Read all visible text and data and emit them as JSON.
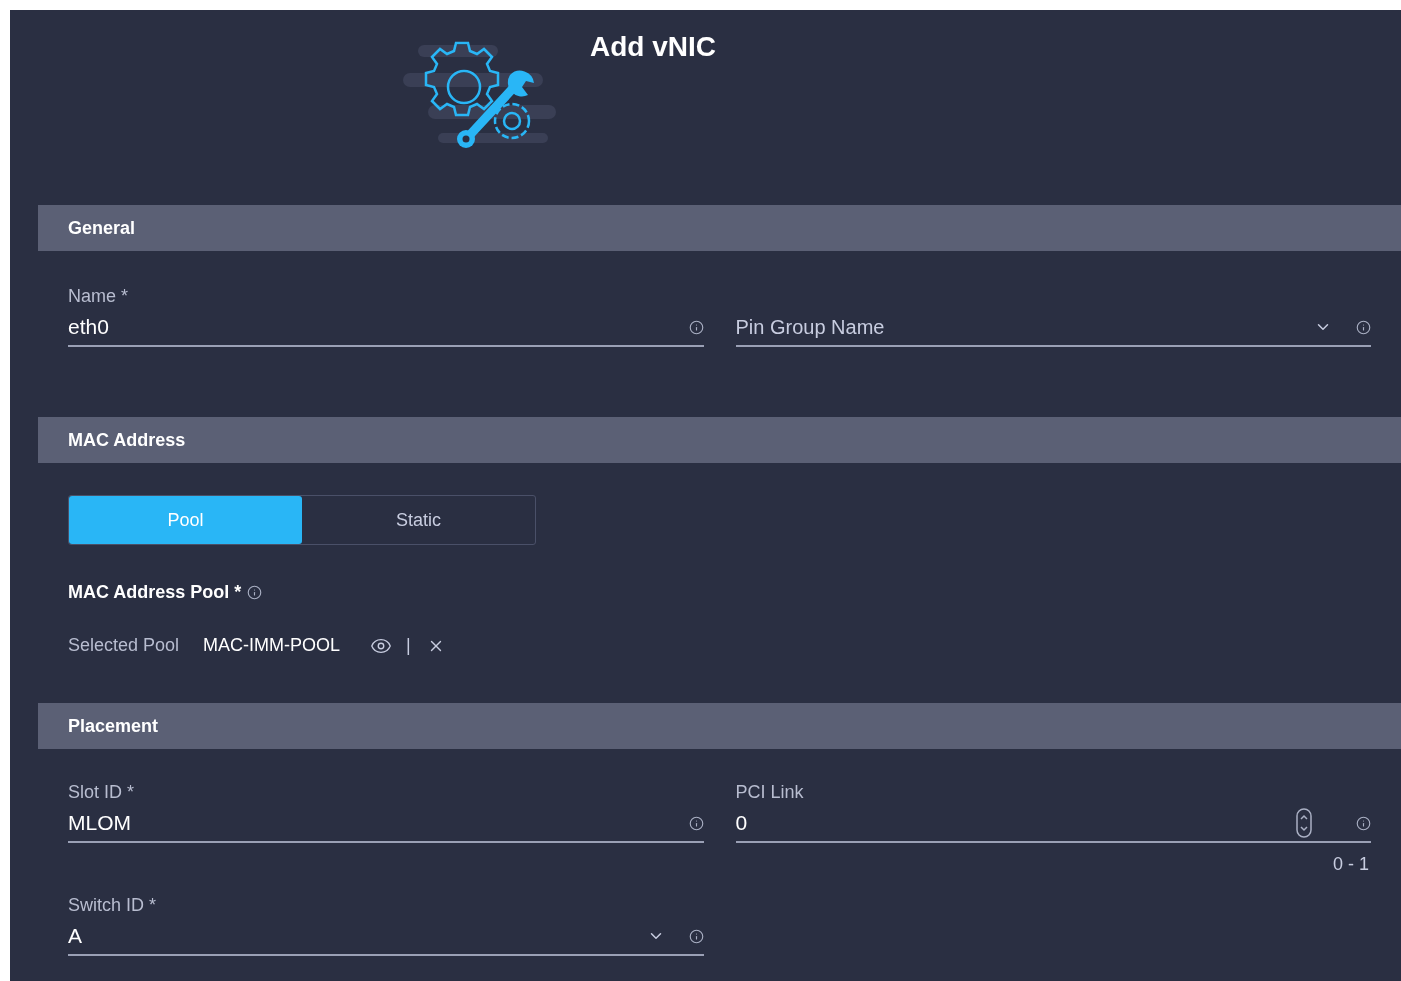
{
  "header": {
    "title": "Add vNIC"
  },
  "general": {
    "title": "General",
    "fields": [
      {
        "kind": "text",
        "label": "Name *",
        "value": "eth0"
      },
      {
        "kind": "select",
        "placeholder": "Pin Group Name"
      }
    ]
  },
  "mac_address": {
    "title": "MAC Address",
    "toggle": [
      {
        "label": "Pool",
        "selected": true
      },
      {
        "label": "Static",
        "selected": false
      }
    ],
    "pool_label": "MAC Address Pool *",
    "selected_label": "Selected Pool",
    "selected_value": "MAC-IMM-POOL",
    "separator": "|"
  },
  "placement": {
    "title": "Placement",
    "fields": [
      {
        "kind": "text",
        "label": "Slot ID *",
        "value": "MLOM"
      },
      {
        "kind": "number",
        "label": "PCI Link",
        "value": "0",
        "range": "0 - 1"
      },
      {
        "kind": "select",
        "label": "Switch ID *",
        "value": "A"
      }
    ]
  }
}
